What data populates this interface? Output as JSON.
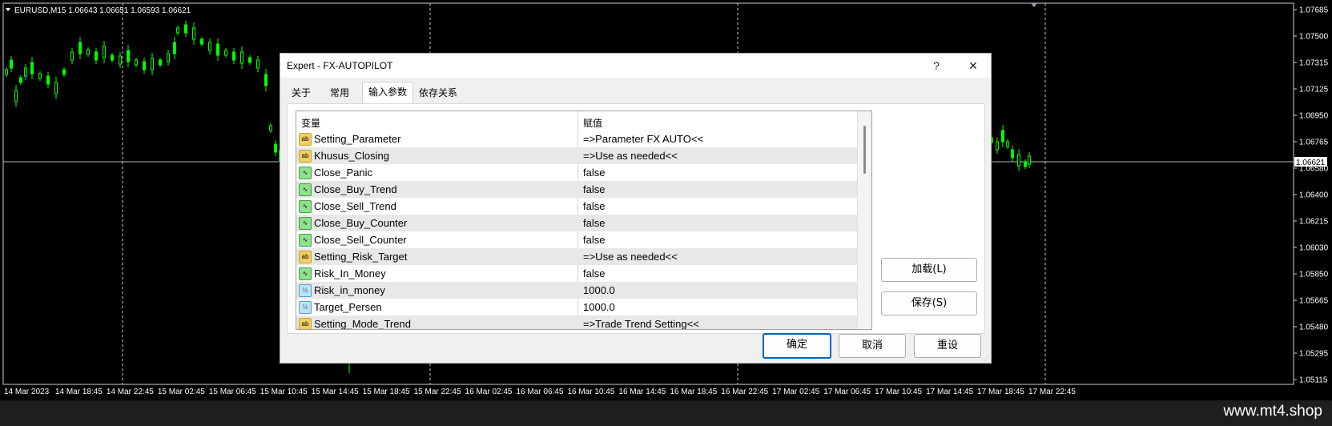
{
  "chart": {
    "header": "EURUSD,M15  1.06643 1.06651 1.06593 1.06621",
    "price_labels": [
      "1.07685",
      "1.07500",
      "1.07315",
      "1.07125",
      "1.06950",
      "1.06765",
      "1.06580",
      "1.06400",
      "1.06215",
      "1.06030",
      "1.05850",
      "1.05665",
      "1.05480",
      "1.05295",
      "1.05115"
    ],
    "current_price": "1.06621",
    "time_labels": [
      "14 Mar 2023",
      "14 Mar 18:45",
      "14 Mar 22:45",
      "15 Mar 02:45",
      "15 Mar 06:45",
      "15 Mar 10:45",
      "15 Mar 14:45",
      "15 Mar 18:45",
      "15 Mar 22:45",
      "16 Mar 02:45",
      "16 Mar 06:45",
      "16 Mar 10:45",
      "16 Mar 14:45",
      "16 Mar 18:45",
      "16 Mar 22:45",
      "17 Mar 02:45",
      "17 Mar 06:45",
      "17 Mar 10:45",
      "17 Mar 14:45",
      "17 Mar 18:45",
      "17 Mar 22:45"
    ],
    "candle_color": "#00ff00"
  },
  "dialog": {
    "title": "Expert - FX-AUTOPILOT",
    "help_label": "?",
    "close_label": "✕",
    "tabs": [
      "关于",
      "常用",
      "输入参数",
      "依存关系"
    ],
    "active_tab": 2,
    "grid": {
      "col_variable": "变量",
      "col_value": "赋值",
      "rows": [
        {
          "icon": "ab",
          "name": "Setting_Parameter",
          "value": "=>Parameter FX AUTO<<"
        },
        {
          "icon": "ab",
          "name": "Khusus_Closing",
          "value": "=>Use as needed<<"
        },
        {
          "icon": "bool",
          "name": "Close_Panic",
          "value": "false"
        },
        {
          "icon": "bool",
          "name": "Close_Buy_Trend",
          "value": "false"
        },
        {
          "icon": "bool",
          "name": "Close_Sell_Trend",
          "value": "false"
        },
        {
          "icon": "bool",
          "name": "Close_Buy_Counter",
          "value": "false"
        },
        {
          "icon": "bool",
          "name": "Close_Sell_Counter",
          "value": "false"
        },
        {
          "icon": "ab",
          "name": "Setting_Risk_Target",
          "value": "=>Use as needed<<"
        },
        {
          "icon": "bool",
          "name": "Risk_In_Money",
          "value": "false"
        },
        {
          "icon": "num",
          "name": "Risk_in_money",
          "value": "1000.0"
        },
        {
          "icon": "num",
          "name": "Target_Persen",
          "value": "1000.0"
        },
        {
          "icon": "ab",
          "name": "Setting_Mode_Trend",
          "value": "=>Trade Trend Setting<<"
        }
      ]
    },
    "buttons": {
      "load": "加载(L)",
      "save": "保存(S)",
      "ok": "确定",
      "cancel": "取消",
      "reset": "重设"
    }
  },
  "footer": {
    "url": "www.mt4.shop"
  }
}
